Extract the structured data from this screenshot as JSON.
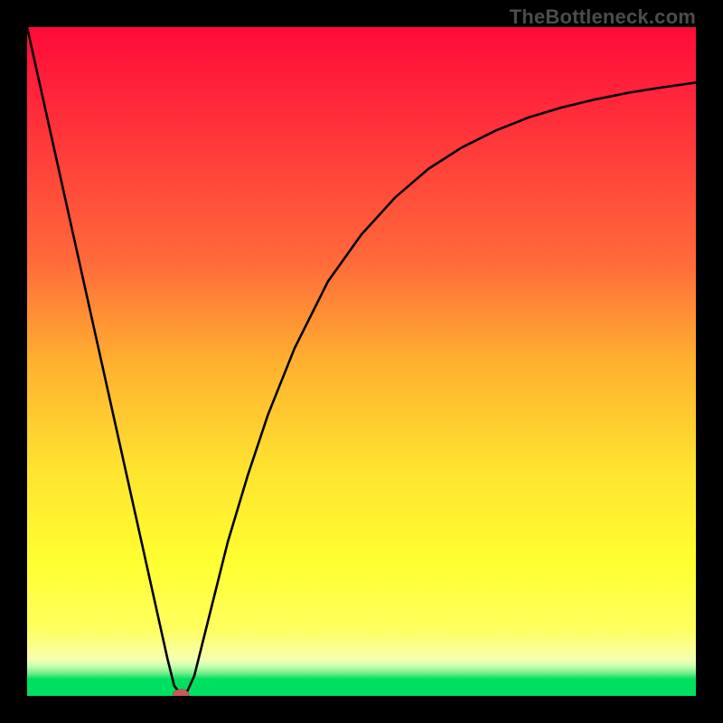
{
  "watermark": "TheBottleneck.com",
  "colors": {
    "gradient_top": "#ff0a3a",
    "gradient_mid_upper": "#ff6a3a",
    "gradient_mid": "#ffb030",
    "gradient_mid_lower": "#ffe330",
    "gradient_yellow_low": "#ffff60",
    "gradient_green": "#00e060",
    "curve": "#000000",
    "marker": "#c95a5a",
    "frame": "#000000"
  },
  "chart_data": {
    "type": "line",
    "title": "",
    "xlabel": "",
    "ylabel": "",
    "xlim": [
      0,
      100
    ],
    "ylim": [
      0,
      100
    ],
    "grid": false,
    "legend": false,
    "annotations": [
      "TheBottleneck.com"
    ],
    "series": [
      {
        "name": "bottleneck-curve",
        "x": [
          0,
          2,
          4,
          6,
          8,
          10,
          12,
          14,
          16,
          18,
          20,
          21,
          22,
          23,
          24,
          25,
          26,
          28,
          30,
          33,
          36,
          40,
          45,
          50,
          55,
          60,
          65,
          70,
          75,
          80,
          85,
          90,
          95,
          100
        ],
        "y": [
          100,
          91,
          82,
          73,
          64,
          55,
          46,
          37,
          28,
          19,
          10,
          5.5,
          1.5,
          0.2,
          0.8,
          3,
          7,
          15,
          23,
          33,
          42,
          52,
          62,
          69,
          74.5,
          78.8,
          82,
          84.5,
          86.5,
          88,
          89.2,
          90.2,
          91,
          91.7
        ]
      }
    ],
    "markers": [
      {
        "name": "min-point",
        "x": 23,
        "y": 0.2
      }
    ]
  }
}
